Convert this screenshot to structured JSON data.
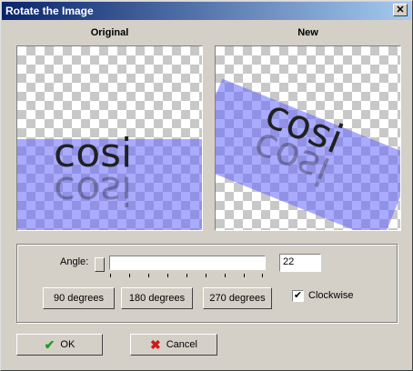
{
  "window": {
    "title": "Rotate the Image",
    "close_symbol": "✕"
  },
  "panels": {
    "original_label": "Original",
    "new_label": "New",
    "image_text": "cosi"
  },
  "angle": {
    "label": "Angle:",
    "value": "22"
  },
  "rotate_buttons": {
    "b90": "90 degrees",
    "b180": "180 degrees",
    "b270": "270 degrees"
  },
  "clockwise": {
    "label": "Clockwise",
    "checked": true,
    "mark": "✔"
  },
  "actions": {
    "ok_label": "OK",
    "cancel_label": "Cancel",
    "ok_icon": "✔",
    "cancel_icon": "✖"
  },
  "colors": {
    "titlebar_start": "#0a246a",
    "titlebar_end": "#a6caf0",
    "overlay": "#6464ff",
    "ok_icon": "#1e9e1e",
    "cancel_icon": "#d01818"
  }
}
